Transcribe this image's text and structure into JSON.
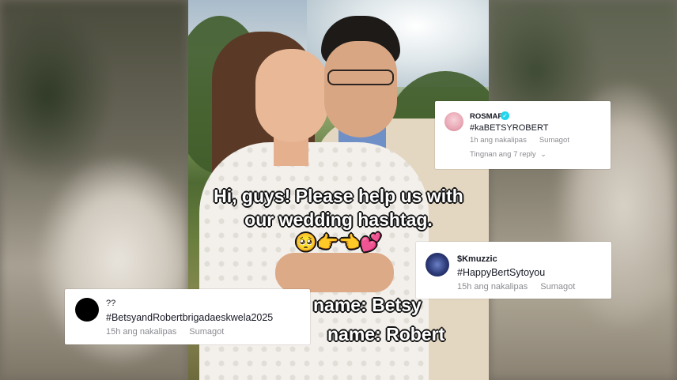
{
  "caption": {
    "line1": "Hi, guys! Please help us with",
    "line2": "our wedding hashtag.",
    "emojis": "🥺👉👈💕",
    "bride_line": "name: Betsy",
    "groom_line": "name: Robert"
  },
  "comments": [
    {
      "username": "ROSMAR",
      "verified": true,
      "text": "#kaBETSYROBERT",
      "time": "1h ang nakalipas",
      "reply_label": "Sumagot",
      "view_replies": "Tingnan ang 7 reply",
      "chevron_icon": "chevron-down-icon"
    },
    {
      "username": "$Kmuzzic",
      "text": "#HappyBertSytoyou",
      "time": "15h ang nakalipas",
      "reply_label": "Sumagot"
    },
    {
      "username": "??",
      "text": "#BetsyandRobertbrigadaeskwela2025",
      "time": "15h ang nakalipas",
      "reply_label": "Sumagot"
    }
  ],
  "colors": {
    "verified_badge": "#20d5ec",
    "meta_text": "#8a8b91",
    "caption_text": "#ffffff"
  }
}
